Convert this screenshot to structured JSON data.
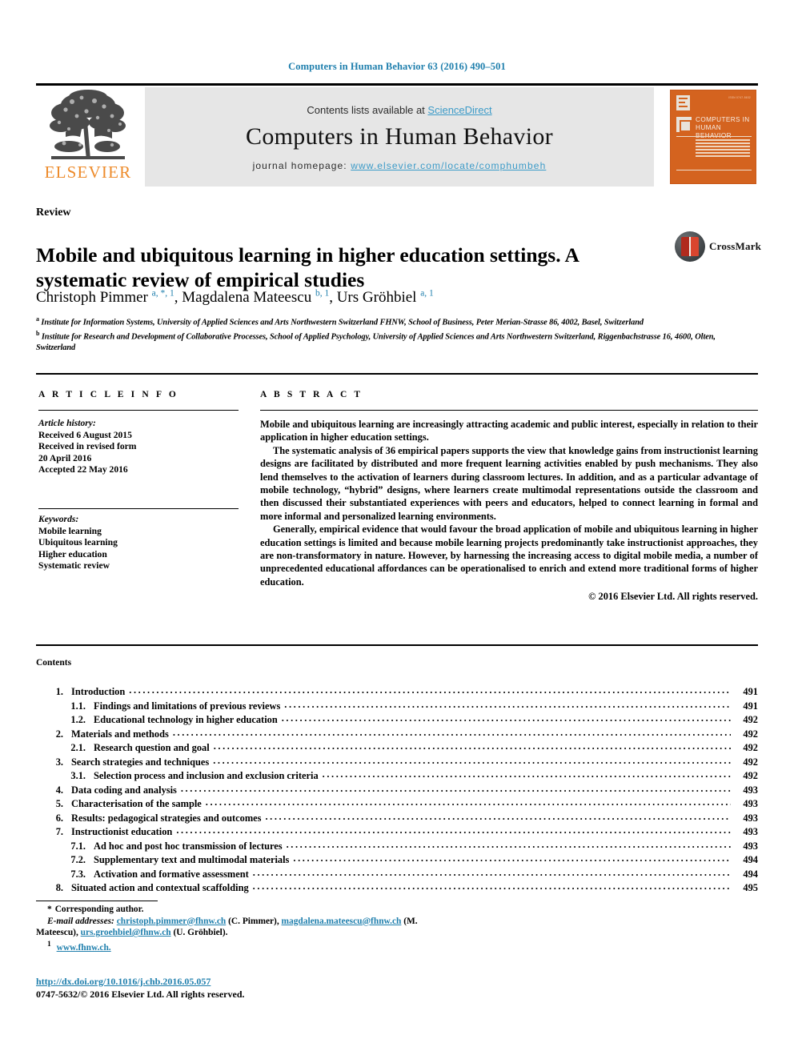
{
  "running_head": "Computers in Human Behavior 63 (2016) 490–501",
  "masthead": {
    "publisher_name": "ELSEVIER",
    "contents_available_prefix": "Contents lists available at ",
    "sciencedirect": "ScienceDirect",
    "journal_name": "Computers in Human Behavior",
    "homepage_prefix": "journal homepage: ",
    "homepage_url": "www.elsevier.com/locate/comphumbeh",
    "cover": {
      "title_line1": "COMPUTERS IN",
      "title_line2": "HUMAN BEHAVIOR",
      "corner_text": "ISSN 0747-5632"
    }
  },
  "article": {
    "type": "Review",
    "title": "Mobile and ubiquitous learning in higher education settings. A systematic review of empirical studies",
    "crossmark_label": "CrossMark",
    "authors_html": "Christoph Pimmer <sup>a, *, 1</sup>, Magdalena Mateescu <sup>b, 1</sup>, Urs Gröhbiel <sup>a, 1</sup>",
    "affiliations": [
      "Institute for Information Systems, University of Applied Sciences and Arts Northwestern Switzerland FHNW, School of Business, Peter Merian-Strasse 86, 4002, Basel, Switzerland",
      "Institute for Research and Development of Collaborative Processes, School of Applied Psychology, University of Applied Sciences and Arts Northwestern Switzerland, Riggenbachstrasse 16, 4600, Olten, Switzerland"
    ]
  },
  "article_info": {
    "heading": "A R T I C L E  I N F O",
    "history_label": "Article history:",
    "history": [
      "Received 6 August 2015",
      "Received in revised form",
      "20 April 2016",
      "Accepted 22 May 2016"
    ],
    "keywords_label": "Keywords:",
    "keywords": [
      "Mobile learning",
      "Ubiquitous learning",
      "Higher education",
      "Systematic review"
    ]
  },
  "abstract": {
    "heading": "A B S T R A C T",
    "paragraphs": [
      "Mobile and ubiquitous learning are increasingly attracting academic and public interest, especially in relation to their application in higher education settings.",
      "The systematic analysis of 36 empirical papers supports the view that knowledge gains from instructionist learning designs are facilitated by distributed and more frequent learning activities enabled by push mechanisms. They also lend themselves to the activation of learners during classroom lectures. In addition, and as a particular advantage of mobile technology, “hybrid” designs, where learners create multimodal representations outside the classroom and then discussed their substantiated experiences with peers and educators, helped to connect learning in formal and more informal and personalized learning environments.",
      "Generally, empirical evidence that would favour the broad application of mobile and ubiquitous learning in higher education settings is limited and because mobile learning projects predominantly take instructionist approaches, they are non-transformatory in nature. However, by harnessing the increasing access to digital mobile media, a number of unprecedented educational affordances can be operationalised to enrich and extend more traditional forms of higher education."
    ],
    "copyright": "© 2016 Elsevier Ltd. All rights reserved."
  },
  "contents": {
    "heading": "Contents",
    "entries": [
      {
        "level": 1,
        "num": "1.",
        "label": "Introduction",
        "page": "491"
      },
      {
        "level": 2,
        "num": "1.1.",
        "label": "Findings and limitations of previous reviews",
        "page": "491"
      },
      {
        "level": 2,
        "num": "1.2.",
        "label": "Educational technology in higher education",
        "page": "492"
      },
      {
        "level": 1,
        "num": "2.",
        "label": "Materials and methods",
        "page": "492"
      },
      {
        "level": 2,
        "num": "2.1.",
        "label": "Research question and goal",
        "page": "492"
      },
      {
        "level": 1,
        "num": "3.",
        "label": "Search strategies and techniques",
        "page": "492"
      },
      {
        "level": 2,
        "num": "3.1.",
        "label": "Selection process and inclusion and exclusion criteria",
        "page": "492"
      },
      {
        "level": 1,
        "num": "4.",
        "label": "Data coding and analysis",
        "page": "493"
      },
      {
        "level": 1,
        "num": "5.",
        "label": "Characterisation of the sample",
        "page": "493"
      },
      {
        "level": 1,
        "num": "6.",
        "label": "Results: pedagogical strategies and outcomes",
        "page": "493"
      },
      {
        "level": 1,
        "num": "7.",
        "label": "Instructionist education",
        "page": "493"
      },
      {
        "level": 2,
        "num": "7.1.",
        "label": "Ad hoc and post hoc transmission of lectures",
        "page": "493"
      },
      {
        "level": 2,
        "num": "7.2.",
        "label": "Supplementary text and multimodal materials",
        "page": "494"
      },
      {
        "level": 2,
        "num": "7.3.",
        "label": "Activation and formative assessment",
        "page": "494"
      },
      {
        "level": 1,
        "num": "8.",
        "label": "Situated action and contextual scaffolding",
        "page": "495"
      }
    ]
  },
  "footnotes": {
    "corresponding_mark": "*",
    "corresponding_text": "Corresponding author.",
    "email_label": "E-mail addresses:",
    "emails": [
      {
        "address": "christoph.pimmer@fhnw.ch",
        "name": "(C. Pimmer)"
      },
      {
        "address": "magdalena.mateescu@fhnw.ch",
        "name": "(M. Mateescu)"
      },
      {
        "address": "urs.groehbiel@fhnw.ch",
        "name": "(U. Gröhbiel)"
      }
    ],
    "note_mark": "1",
    "note_text": "www.fhnw.ch."
  },
  "imprint": {
    "doi": "http://dx.doi.org/10.1016/j.chb.2016.05.057",
    "issn_line": "0747-5632/© 2016 Elsevier Ltd. All rights reserved."
  },
  "colors": {
    "link_blue": "#1f7fad",
    "sciencedirect_blue": "#3c9bc8",
    "elsevier_orange": "#ed8b2b",
    "cover_orange": "#d4631f",
    "banner_grey": "#e6e6e6"
  }
}
